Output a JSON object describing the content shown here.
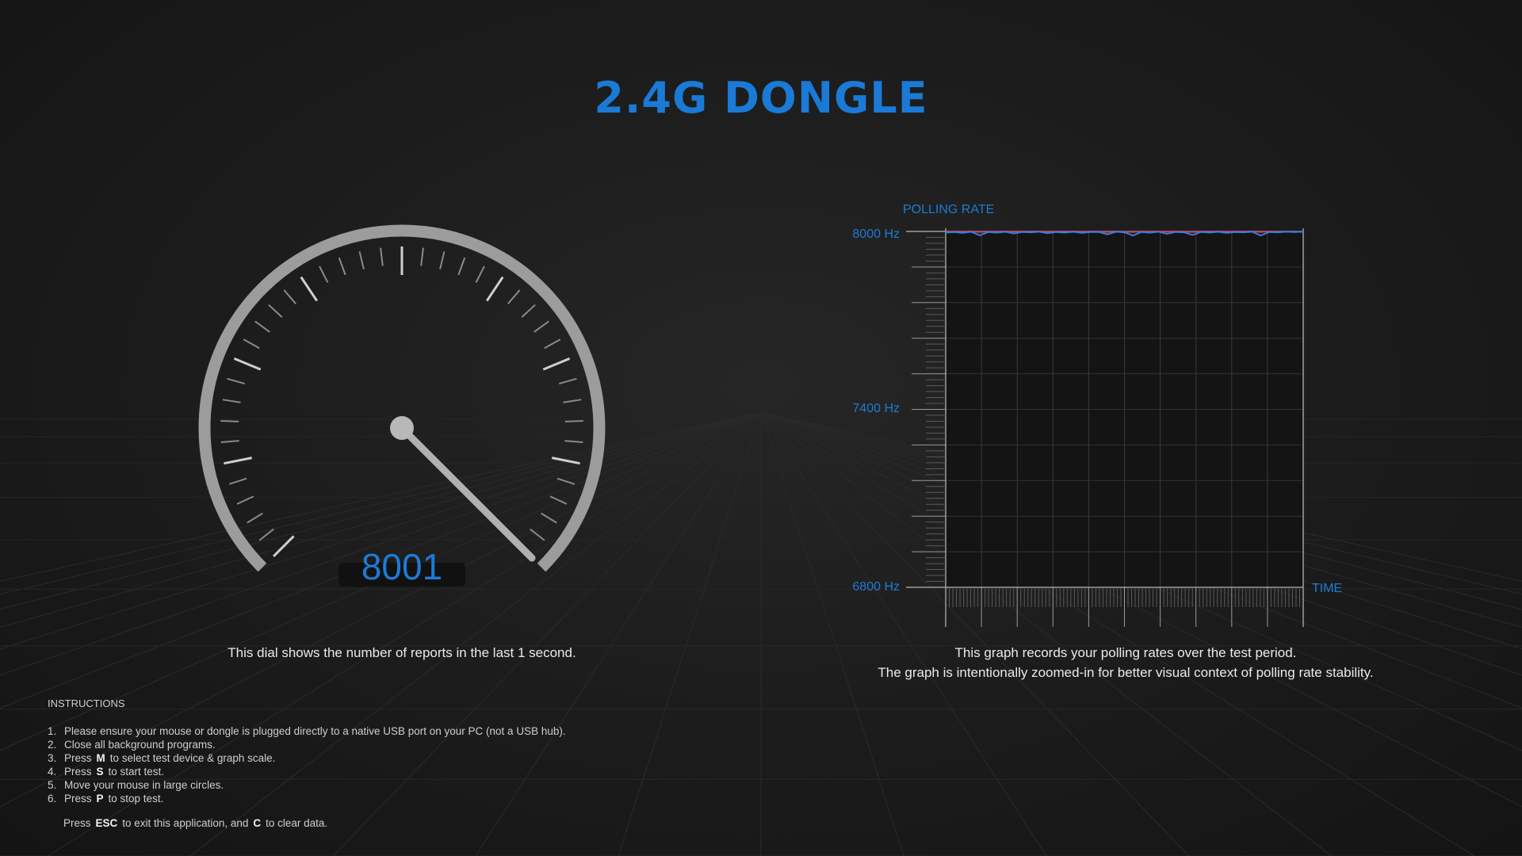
{
  "title": "2.4G DONGLE",
  "dial": {
    "value": "8001",
    "caption": "This dial shows the number of reports in the last 1 second."
  },
  "graph": {
    "title": "POLLING RATE",
    "y_labels": [
      "8000 Hz",
      "7400 Hz",
      "6800 Hz"
    ],
    "x_label": "TIME",
    "caption_line1": "This graph records your polling rates over the test period.",
    "caption_line2": "The graph is intentionally zoomed-in for better visual context of polling rate stability."
  },
  "chart_data": {
    "type": "line",
    "title": "POLLING RATE",
    "xlabel": "TIME",
    "ylabel": "",
    "ylim": [
      6800,
      8000
    ],
    "y_ticks": [
      6800,
      7400,
      8000
    ],
    "grid": true,
    "series": [
      {
        "color": "#3a7be0",
        "values": [
          7996,
          7998,
          7995,
          7999,
          7987,
          7998,
          7996,
          7999,
          7993,
          7998,
          7997,
          7999,
          7994,
          7998,
          7996,
          7999,
          7995,
          7998,
          7998,
          7990,
          7999,
          7997,
          7986,
          7998,
          7996,
          7999,
          7992,
          7998,
          7997,
          7988,
          7998,
          7996,
          7999,
          7995,
          7998,
          7997,
          7999,
          7986,
          7998,
          7997,
          7999,
          7998,
          7999
        ]
      },
      {
        "color": "#c0405a",
        "values": [
          7999,
          8000,
          7999,
          8000,
          7998,
          8000,
          7999,
          8000,
          7999,
          8000,
          7999,
          8000,
          7999,
          8000,
          7999,
          8000,
          7999,
          8000,
          7999,
          7998,
          8000,
          7999,
          7998,
          8000,
          7999,
          8000,
          7999,
          8000,
          7999,
          7998,
          8000,
          7999,
          8000,
          7999,
          8000,
          7999,
          8000,
          7998,
          8000,
          7999,
          8000,
          7999,
          8000
        ]
      }
    ]
  },
  "instructions": {
    "heading": "INSTRUCTIONS",
    "items": [
      {
        "num": "1.",
        "pre": "Please ensure your mouse or dongle is plugged directly to a native USB port on your PC (not a USB hub).",
        "key": "",
        "post": ""
      },
      {
        "num": "2.",
        "pre": "Close all background programs.",
        "key": "",
        "post": ""
      },
      {
        "num": "3.",
        "pre": "Press",
        "key": "M",
        "post": "to select test device & graph scale."
      },
      {
        "num": "4.",
        "pre": "Press",
        "key": "S",
        "post": "to start test."
      },
      {
        "num": "5.",
        "pre": "Move your mouse in large circles.",
        "key": "",
        "post": ""
      },
      {
        "num": "6.",
        "pre": "Press",
        "key": "P",
        "post": "to stop test."
      }
    ],
    "footer": {
      "pre": "Press",
      "key1": "ESC",
      "mid": "to exit this application, and",
      "key2": "C",
      "post": "to clear data."
    }
  },
  "colors": {
    "accent": "#1a7ad6",
    "needle": "#b3b3b3",
    "series_blue": "#3a7be0",
    "series_red": "#c0405a"
  }
}
